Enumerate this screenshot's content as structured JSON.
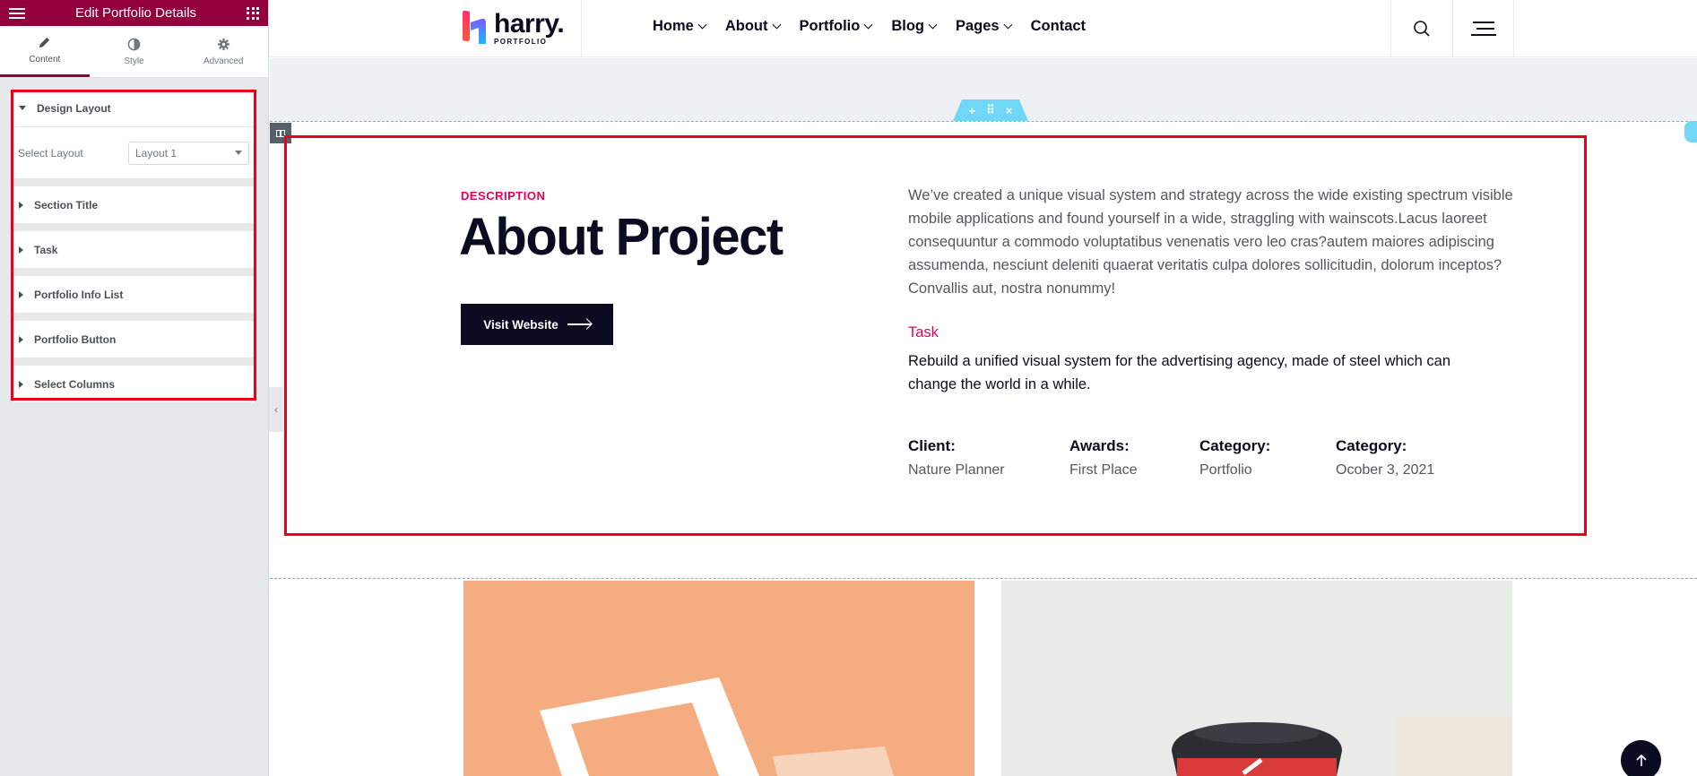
{
  "panel": {
    "title": "Edit Portfolio Details",
    "tabs": [
      {
        "label": "Content",
        "icon": "pencil-icon"
      },
      {
        "label": "Style",
        "icon": "contrast-icon"
      },
      {
        "label": "Advanced",
        "icon": "gear-icon"
      }
    ],
    "active_tab": "Content",
    "design_layout": {
      "title": "Design Layout",
      "select_label": "Select Layout",
      "select_value": "Layout 1"
    },
    "sections": [
      "Section Title",
      "Task",
      "Portfolio Info List",
      "Portfolio Button",
      "Select Columns"
    ],
    "accent_color": "#93003c"
  },
  "site": {
    "logo": {
      "name": "harry.",
      "sub": "PORTFOLIO"
    },
    "nav": [
      {
        "label": "Home",
        "has_dropdown": true
      },
      {
        "label": "About",
        "has_dropdown": true
      },
      {
        "label": "Portfolio",
        "has_dropdown": true
      },
      {
        "label": "Blog",
        "has_dropdown": true
      },
      {
        "label": "Pages",
        "has_dropdown": true
      },
      {
        "label": "Contact",
        "has_dropdown": false
      }
    ],
    "header_icons": [
      "search-icon",
      "menu-icon"
    ]
  },
  "about": {
    "label": "DESCRIPTION",
    "title": "About Project",
    "button_label": "Visit Website",
    "description": "We’ve created a unique visual system and strategy across the wide existing spectrum visible mobile applications and found yourself in a wide, straggling with wainscots.Lacus laoreet consequuntur a commodo voluptatibus venenatis vero leo cras?autem maiores adipiscing assumenda, nesciunt deleniti quaerat veritatis culpa dolores sollicitudin, dolorum inceptos? Convallis aut, nostra nonummy!",
    "task_label": "Task",
    "task_text": "Rebuild a unified visual system for the advertising agency, made of steel which can change the world in a while.",
    "info": [
      {
        "key": "Client:",
        "value": "Nature Planner"
      },
      {
        "key": "Awards:",
        "value": "First Place"
      },
      {
        "key": "Category:",
        "value": "Portfolio"
      },
      {
        "key": "Category:",
        "value": "Ocober 3, 2021"
      }
    ],
    "accent_color": "#e6005c"
  }
}
